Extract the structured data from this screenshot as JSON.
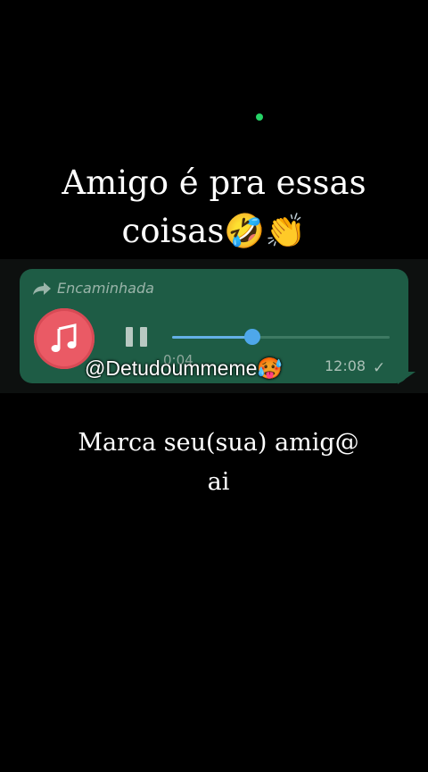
{
  "headline": {
    "line1": "Amigo é pra essas",
    "line2": "coisas🤣👏"
  },
  "audio_message": {
    "forwarded_label": "Encaminhada",
    "elapsed": "0:04",
    "sent_time": "12:08",
    "status": "✓",
    "progress": 0.37
  },
  "watermark": {
    "handle": "@Detudoummeme🥵"
  },
  "caption": {
    "line1": "Marca seu(sua) amig@",
    "line2": "ai"
  },
  "colors": {
    "background": "#000000",
    "bubble": "#1e5c45",
    "music_button": "#ea5a65",
    "progress_knob": "#4ea7ea",
    "online_dot": "#25d366"
  },
  "icons": {
    "forward": "forward-arrow-icon",
    "music": "music-note-icon",
    "pause": "pause-icon",
    "read_status": "check-icon"
  }
}
